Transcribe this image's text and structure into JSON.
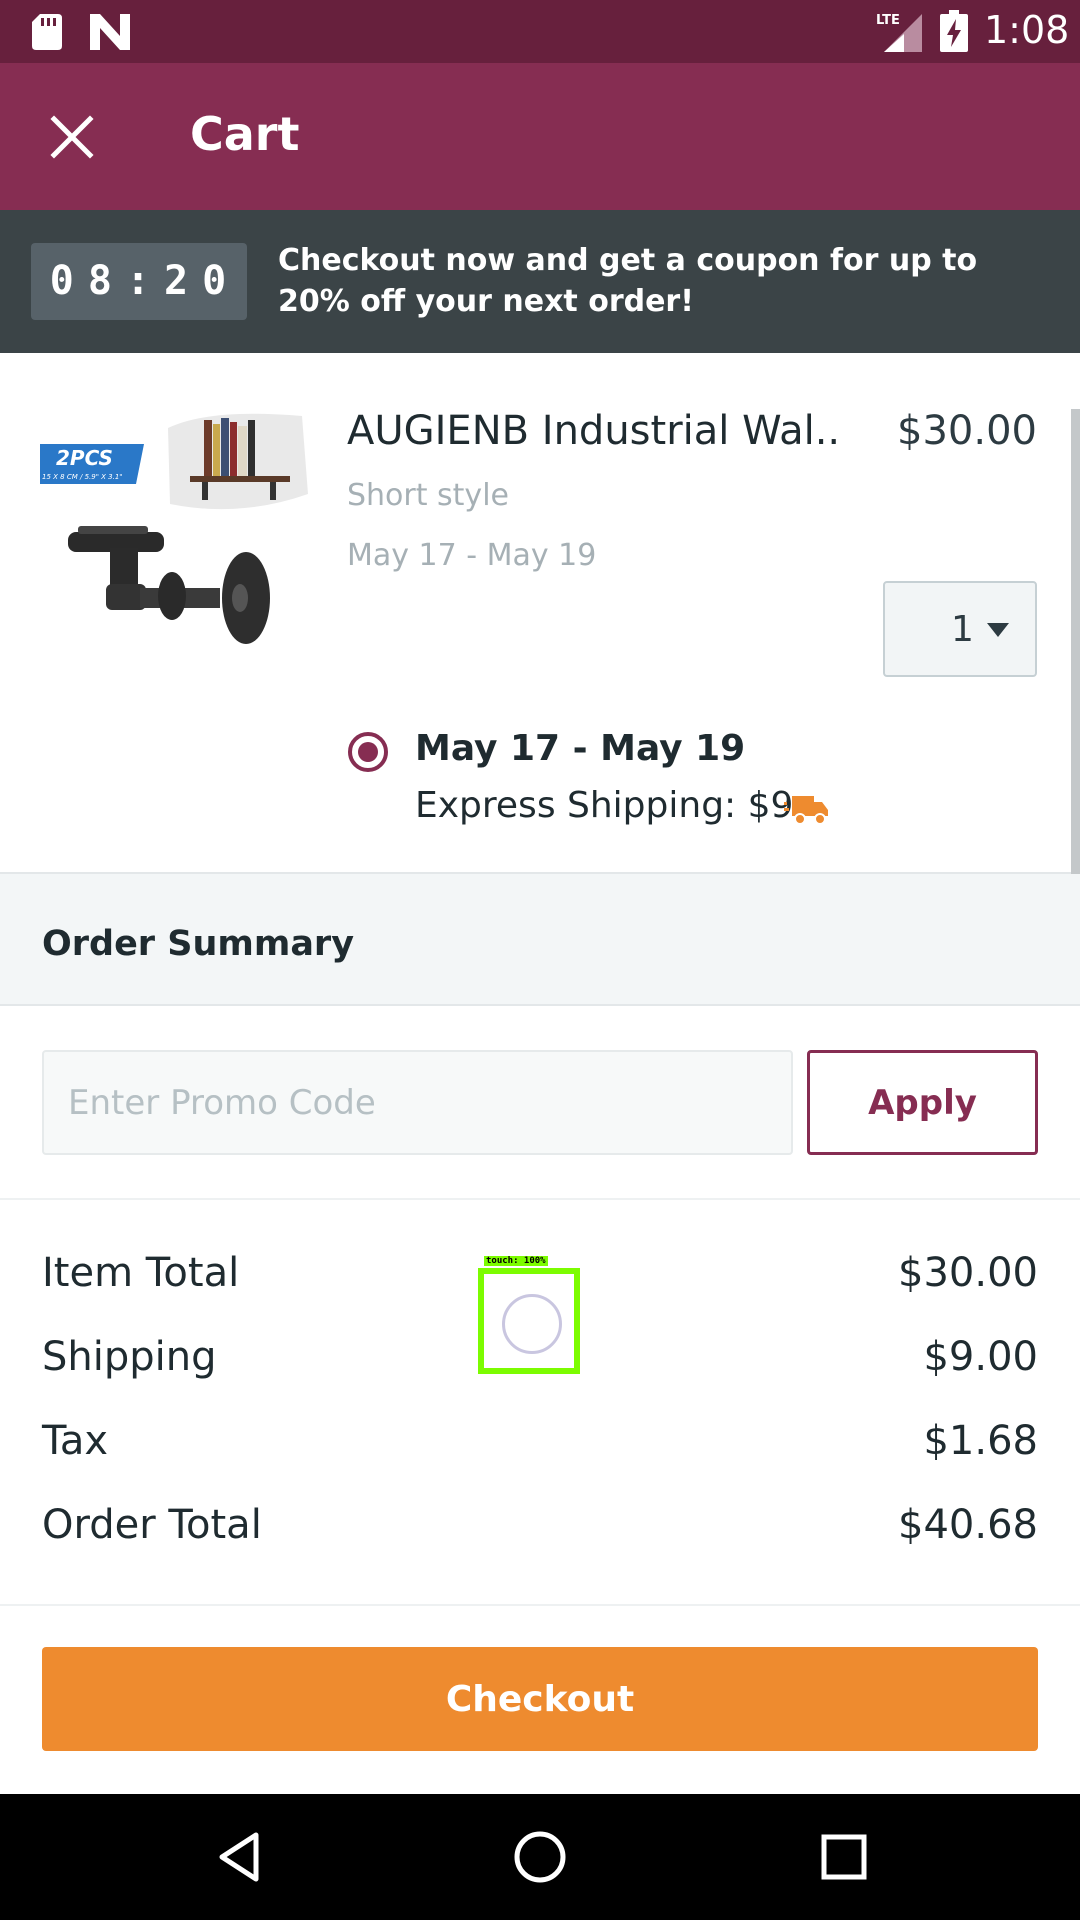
{
  "status_bar": {
    "time": "1:08",
    "icons": [
      "sd-card-icon",
      "n-icon",
      "lte-signal-icon",
      "battery-charging-icon"
    ],
    "lte_text": "LTE"
  },
  "app_bar": {
    "title": "Cart",
    "close_icon": "close-icon"
  },
  "banner": {
    "timer": "08:20",
    "message": "Checkout now and get a coupon for up to 20% off your next order!"
  },
  "product": {
    "image_text": "2PCS",
    "image_subtext": "15 X 8 CM / 5.9\" X 3.1\"",
    "name": "AUGIENB Industrial Wal...",
    "price": "$30.00",
    "variant": "Short style",
    "dates": "May 17 - May 19",
    "quantity": "1",
    "shipping": {
      "selected": true,
      "date": "May 17 - May 19",
      "method": "Express Shipping: $9",
      "icon": "truck-icon"
    }
  },
  "summary": {
    "header": "Order Summary",
    "promo_placeholder": "Enter Promo Code",
    "promo_value": "",
    "apply_label": "Apply",
    "rows": [
      {
        "label": "Item Total",
        "value": "$30.00"
      },
      {
        "label": "Shipping",
        "value": "$9.00"
      },
      {
        "label": "Tax",
        "value": "$1.68"
      },
      {
        "label": "Order Total",
        "value": "$40.68"
      }
    ]
  },
  "touch_indicator": {
    "label": "touch: 100%"
  },
  "checkout_label": "Checkout",
  "nav_bar": {
    "buttons": [
      "back-icon",
      "home-icon",
      "recents-icon"
    ]
  },
  "colors": {
    "status_bar": "#67203d",
    "app_bar": "#862d52",
    "banner": "#3b4447",
    "accent": "#862d52",
    "checkout": "#ee8b2f"
  }
}
